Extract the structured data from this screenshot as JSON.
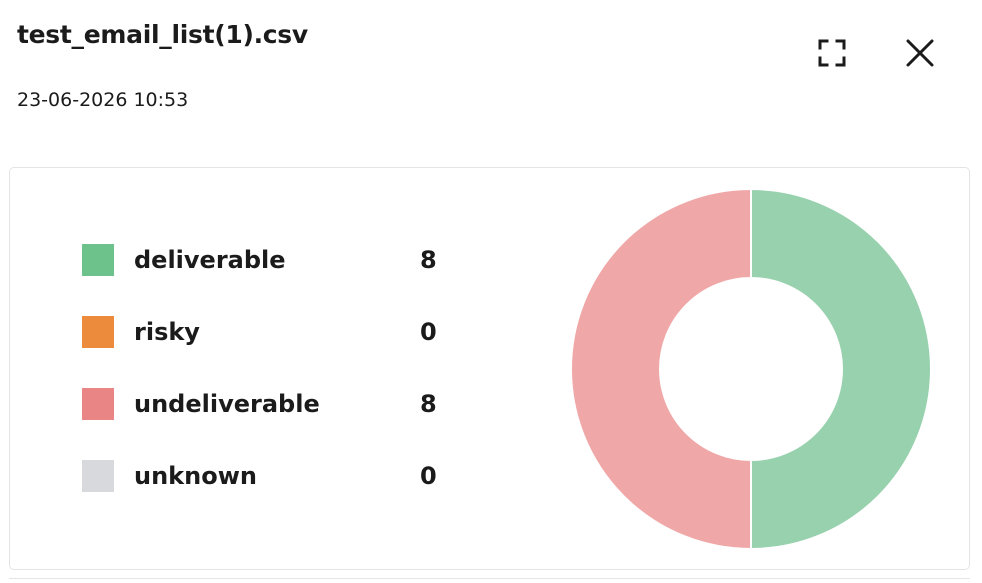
{
  "header": {
    "title": "test_email_list(1).csv",
    "timestamp": "23-06-2026 10:53",
    "expand_icon": "fullscreen-icon",
    "close_icon": "close-icon"
  },
  "colors": {
    "deliverable": "#6cc28a",
    "risky": "#ec8b3b",
    "undeliverable": "#ea8585",
    "unknown": "#d7d9dc",
    "donut_deliverable": "#98d1ae",
    "donut_undeliverable": "#f0a7a7"
  },
  "legend": [
    {
      "label": "deliverable",
      "value": "8"
    },
    {
      "label": "risky",
      "value": "0"
    },
    {
      "label": "undeliverable",
      "value": "8"
    },
    {
      "label": "unknown",
      "value": "0"
    }
  ],
  "chart_data": {
    "type": "pie",
    "donut": true,
    "categories": [
      "deliverable",
      "risky",
      "undeliverable",
      "unknown"
    ],
    "values": [
      8,
      0,
      8,
      0
    ],
    "title": ""
  }
}
